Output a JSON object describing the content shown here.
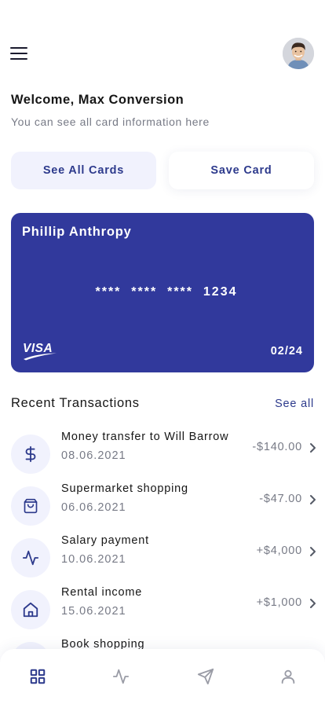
{
  "header": {
    "menu_icon": "hamburger-menu-icon",
    "avatar": "user-avatar-photo"
  },
  "welcome": {
    "title": "Welcome, Max Conversion",
    "subtitle": "You can see all card information here"
  },
  "actions": {
    "see_all_cards": "See All Cards",
    "save_card": "Save Card"
  },
  "card": {
    "holder": "Phillip Anthropy",
    "number": "****  ****  ****  1234",
    "brand": "VISA",
    "expiry": "02/24",
    "color": "#31399c"
  },
  "transactions": {
    "title": "Recent Transactions",
    "see_all": "See all",
    "items": [
      {
        "icon": "dollar-icon",
        "title": "Money transfer to Will Barrow",
        "date": "08.06.2021",
        "amount": "-$140.00"
      },
      {
        "icon": "shopping-bag-icon",
        "title": "Supermarket shopping",
        "date": "06.06.2021",
        "amount": "-$47.00"
      },
      {
        "icon": "activity-icon",
        "title": "Salary payment",
        "date": "10.06.2021",
        "amount": "+$4,000"
      },
      {
        "icon": "home-icon",
        "title": "Rental income",
        "date": "15.06.2021",
        "amount": "+$1,000"
      },
      {
        "icon": "book-icon",
        "title": "Book shopping",
        "date": "",
        "amount": ""
      }
    ]
  },
  "bottom_nav": {
    "items": [
      {
        "icon": "grid-icon",
        "active": true
      },
      {
        "icon": "activity-icon",
        "active": false
      },
      {
        "icon": "send-icon",
        "active": false
      },
      {
        "icon": "user-icon",
        "active": false
      }
    ]
  },
  "colors": {
    "accent": "#2d3a8c",
    "card": "#31399c",
    "icon_bg": "#f1f2fd",
    "muted_text": "#777a86"
  }
}
